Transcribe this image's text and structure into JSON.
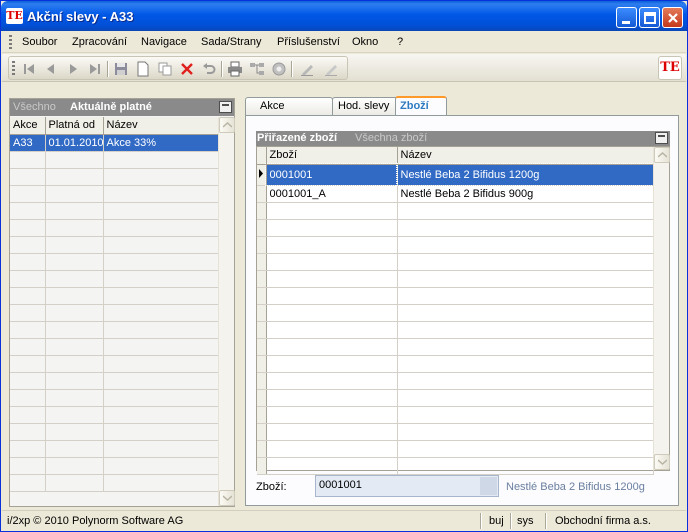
{
  "window": {
    "title": "Akční slevy - A33",
    "app_icon_text": "ТЕ"
  },
  "menu": {
    "items": [
      "Soubor",
      "Zpracování",
      "Navigace",
      "Sada/Strany",
      "Příslušenství",
      "Okno",
      "?"
    ]
  },
  "toolbar": {
    "icons": [
      "first-icon",
      "prev-icon",
      "next-icon",
      "last-icon",
      "save-icon",
      "new-icon",
      "copy-icon",
      "delete-icon",
      "undo-icon",
      "print-icon",
      "tree-icon",
      "refresh-icon",
      "edit-icon",
      "edit-off-icon"
    ],
    "logo_text": "ТЕ"
  },
  "left_panel": {
    "filter_all": "Všechno",
    "filter_current": "Aktuálně platné",
    "columns": [
      "Akce",
      "Platná od",
      "Název"
    ],
    "rows": [
      [
        "A33",
        "01.01.2010",
        "Akce 33%"
      ]
    ]
  },
  "tabs": [
    {
      "label": "Akce"
    },
    {
      "label": "Hod. slevy"
    },
    {
      "label": "Zboží"
    }
  ],
  "right_panel": {
    "filter_assigned": "Přiřazené zboží",
    "filter_all": "Všechna zboží",
    "columns": [
      "Zboží",
      "Název"
    ],
    "rows": [
      [
        "0001001",
        "Nestlé Beba 2 Bifidus 1200g"
      ],
      [
        "0001001_A",
        "Nestlé Beba 2 Bifidus 900g"
      ]
    ],
    "field_label": "Zboží:",
    "field_value": "0001001",
    "field_description": "Nestlé Beba 2 Bifidus 1200g"
  },
  "status": {
    "copyright": "i/2xp © 2010 Polynorm Software AG",
    "user": "buj",
    "db": "sys",
    "company": "Obchodní firma a.s."
  },
  "colors": {
    "selection": "#316ac5",
    "header_gray": "#8a8a8a",
    "tab_accent": "#ff9a2a"
  }
}
